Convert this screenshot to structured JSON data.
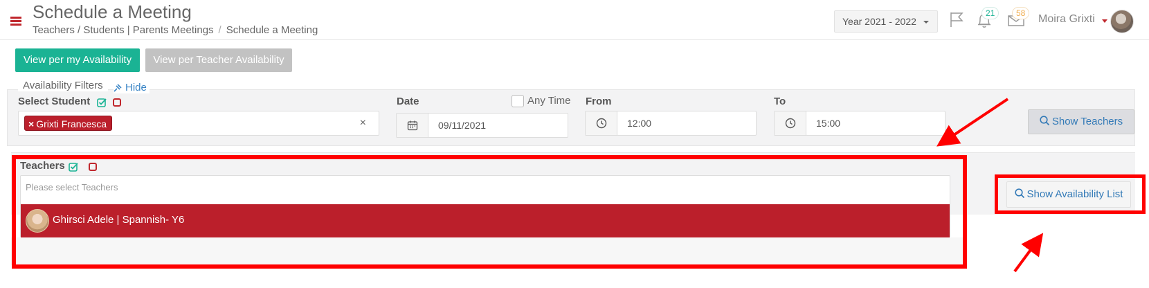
{
  "header": {
    "title": "Schedule a Meeting",
    "breadcrumb": [
      "Teachers / Students | Parents Meetings",
      "Schedule a Meeting"
    ],
    "breadcrumb_separator": "/",
    "year_select": "Year 2021 - 2022",
    "notifications_count": "21",
    "messages_count": "58",
    "user_name": "Moira Grixti"
  },
  "view_buttons": {
    "my_availability": "View per my Availability",
    "teacher_availability": "View per Teacher Availability"
  },
  "filters": {
    "legend": "Availability Filters",
    "hide_label": "Hide",
    "student_label": "Select Student",
    "selected_student": "Grixti Francesca",
    "tag_remove": "×",
    "clear": "×",
    "date_label": "Date",
    "any_time_label": "Any Time",
    "date_value": "09/11/2021",
    "from_label": "From",
    "from_value": "12:00",
    "to_label": "To",
    "to_value": "15:00",
    "show_teachers_label": "Show Teachers"
  },
  "teachers": {
    "label": "Teachers",
    "placeholder": "Please select Teachers",
    "options": [
      {
        "name": "Ghirsci Adele | Spannish- Y6"
      }
    ],
    "show_availability_label": "Show Availability List"
  },
  "colors": {
    "accent_green": "#1ab394",
    "accent_red": "#bb1f2b",
    "annotation_red": "#ff0000",
    "link_blue": "#337ab7"
  }
}
